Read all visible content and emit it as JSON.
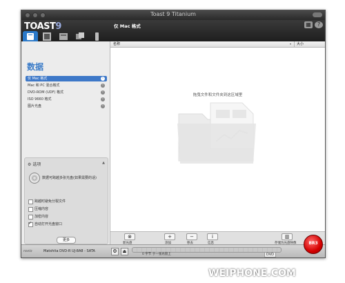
{
  "window": {
    "title": "Toast 9 Titanium"
  },
  "toolbar": {
    "logo": "TOAST",
    "logo_version": "9",
    "section_title": "仅 Mac 格式",
    "help": "?"
  },
  "sidebar": {
    "title": "数据",
    "formats": [
      {
        "label": "仅 Mac 格式",
        "selected": true
      },
      {
        "label": "Mac 和 PC 混合格式",
        "selected": false
      },
      {
        "label": "DVD-ROM (UDF) 格式",
        "selected": false
      },
      {
        "label": "ISO 9660 格式",
        "selected": false
      },
      {
        "label": "图片光盘",
        "selected": false
      }
    ],
    "info_glyph": "i",
    "options": {
      "header": "选项",
      "description": "数据可跨越多张光盘(如果需要的话)",
      "checkboxes": [
        {
          "label": "跨越时避免分裂文件",
          "checked": false
        },
        {
          "label": "压缩内容",
          "checked": false
        },
        {
          "label": "加密内容",
          "checked": false
        },
        {
          "label": "自动打开光盘窗口",
          "checked": true
        }
      ],
      "more_button": "更多"
    }
  },
  "content": {
    "columns": {
      "name": "名称",
      "size": "大小"
    },
    "drop_hint": "拖曳文件和文件夹到这区域里"
  },
  "actions": [
    {
      "label": "新光盘",
      "glyph": "⊗"
    },
    {
      "label": "添加",
      "glyph": "+"
    },
    {
      "label": "移去",
      "glyph": "−"
    },
    {
      "label": "信息",
      "glyph": "i"
    },
    {
      "label": "存储为光盘映像",
      "glyph": "▥"
    }
  ],
  "status": {
    "brand": "roxio",
    "drive": "Matshita DVD-R   UJ-8A8 - SATA",
    "size_text": "0 字节 于一张光盘上",
    "disc_type": "DVD"
  },
  "burn_button": {
    "label": "BR3"
  },
  "watermark": "WEIPHONE.COM",
  "colors": {
    "accent": "#3d78c8",
    "burn": "#d40000",
    "toolbar": "#2a2a2a"
  }
}
